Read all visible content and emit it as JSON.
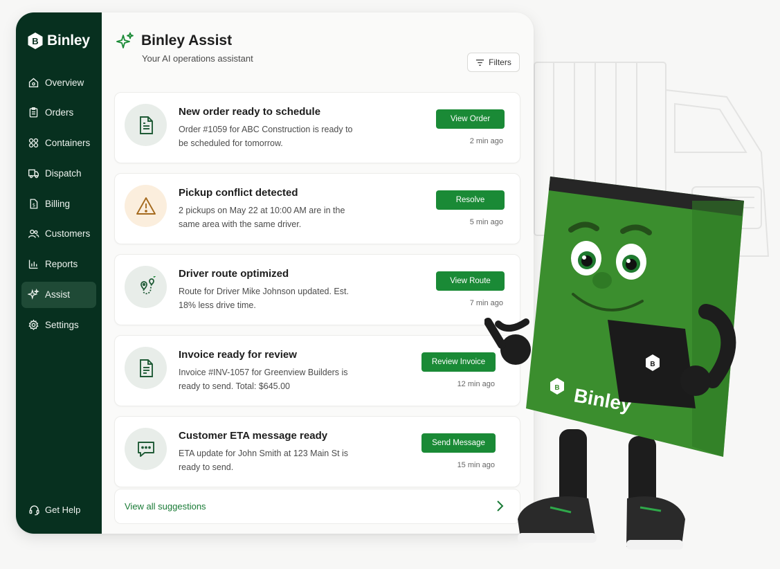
{
  "brand": {
    "name": "Binley"
  },
  "sidebar": {
    "items": [
      {
        "label": "Overview",
        "icon": "home-icon"
      },
      {
        "label": "Orders",
        "icon": "clipboard-icon"
      },
      {
        "label": "Containers",
        "icon": "containers-icon"
      },
      {
        "label": "Dispatch",
        "icon": "truck-icon"
      },
      {
        "label": "Billing",
        "icon": "dollar-document-icon"
      },
      {
        "label": "Customers",
        "icon": "users-icon"
      },
      {
        "label": "Reports",
        "icon": "bar-chart-icon"
      },
      {
        "label": "Assist",
        "icon": "sparkle-icon",
        "active": true
      },
      {
        "label": "Settings",
        "icon": "gear-icon"
      }
    ],
    "help_label": "Get Help"
  },
  "header": {
    "title": "Binley Assist",
    "subtitle": "Your AI operations assistant",
    "filters_label": "Filters"
  },
  "suggestions": [
    {
      "title": "New order ready to schedule",
      "body": "Order #1059 for ABC Construction is ready to be scheduled for tomorrow.",
      "button": "View Order",
      "time": "2 min ago",
      "icon": "document-icon"
    },
    {
      "title": "Pickup conflict detected",
      "body": "2 pickups on May 22 at 10:00 AM are in the same area with the same driver.",
      "button": "Resolve",
      "time": "5 min ago",
      "icon": "warning-icon"
    },
    {
      "title": "Driver route optimized",
      "body": "Route for Driver Mike Johnson updated. Est. 18% less drive time.",
      "button": "View Route",
      "time": "7 min ago",
      "icon": "route-icon"
    },
    {
      "title": "Invoice ready for review",
      "body": "Invoice #INV-1057 for Greenview Builders is ready to send. Total: $645.00",
      "button": "Review Invoice",
      "time": "12 min ago",
      "icon": "invoice-icon"
    },
    {
      "title": "Customer ETA message ready",
      "body": "ETA update for John Smith at 123 Main St is ready to send.",
      "button": "Send Message",
      "time": "15 min ago",
      "icon": "chat-icon"
    }
  ],
  "view_all_label": "View all suggestions",
  "mascot": {
    "label": "Binley"
  },
  "colors": {
    "sidebar": "#07301f",
    "accent": "#1a8a36",
    "link": "#187a35"
  }
}
